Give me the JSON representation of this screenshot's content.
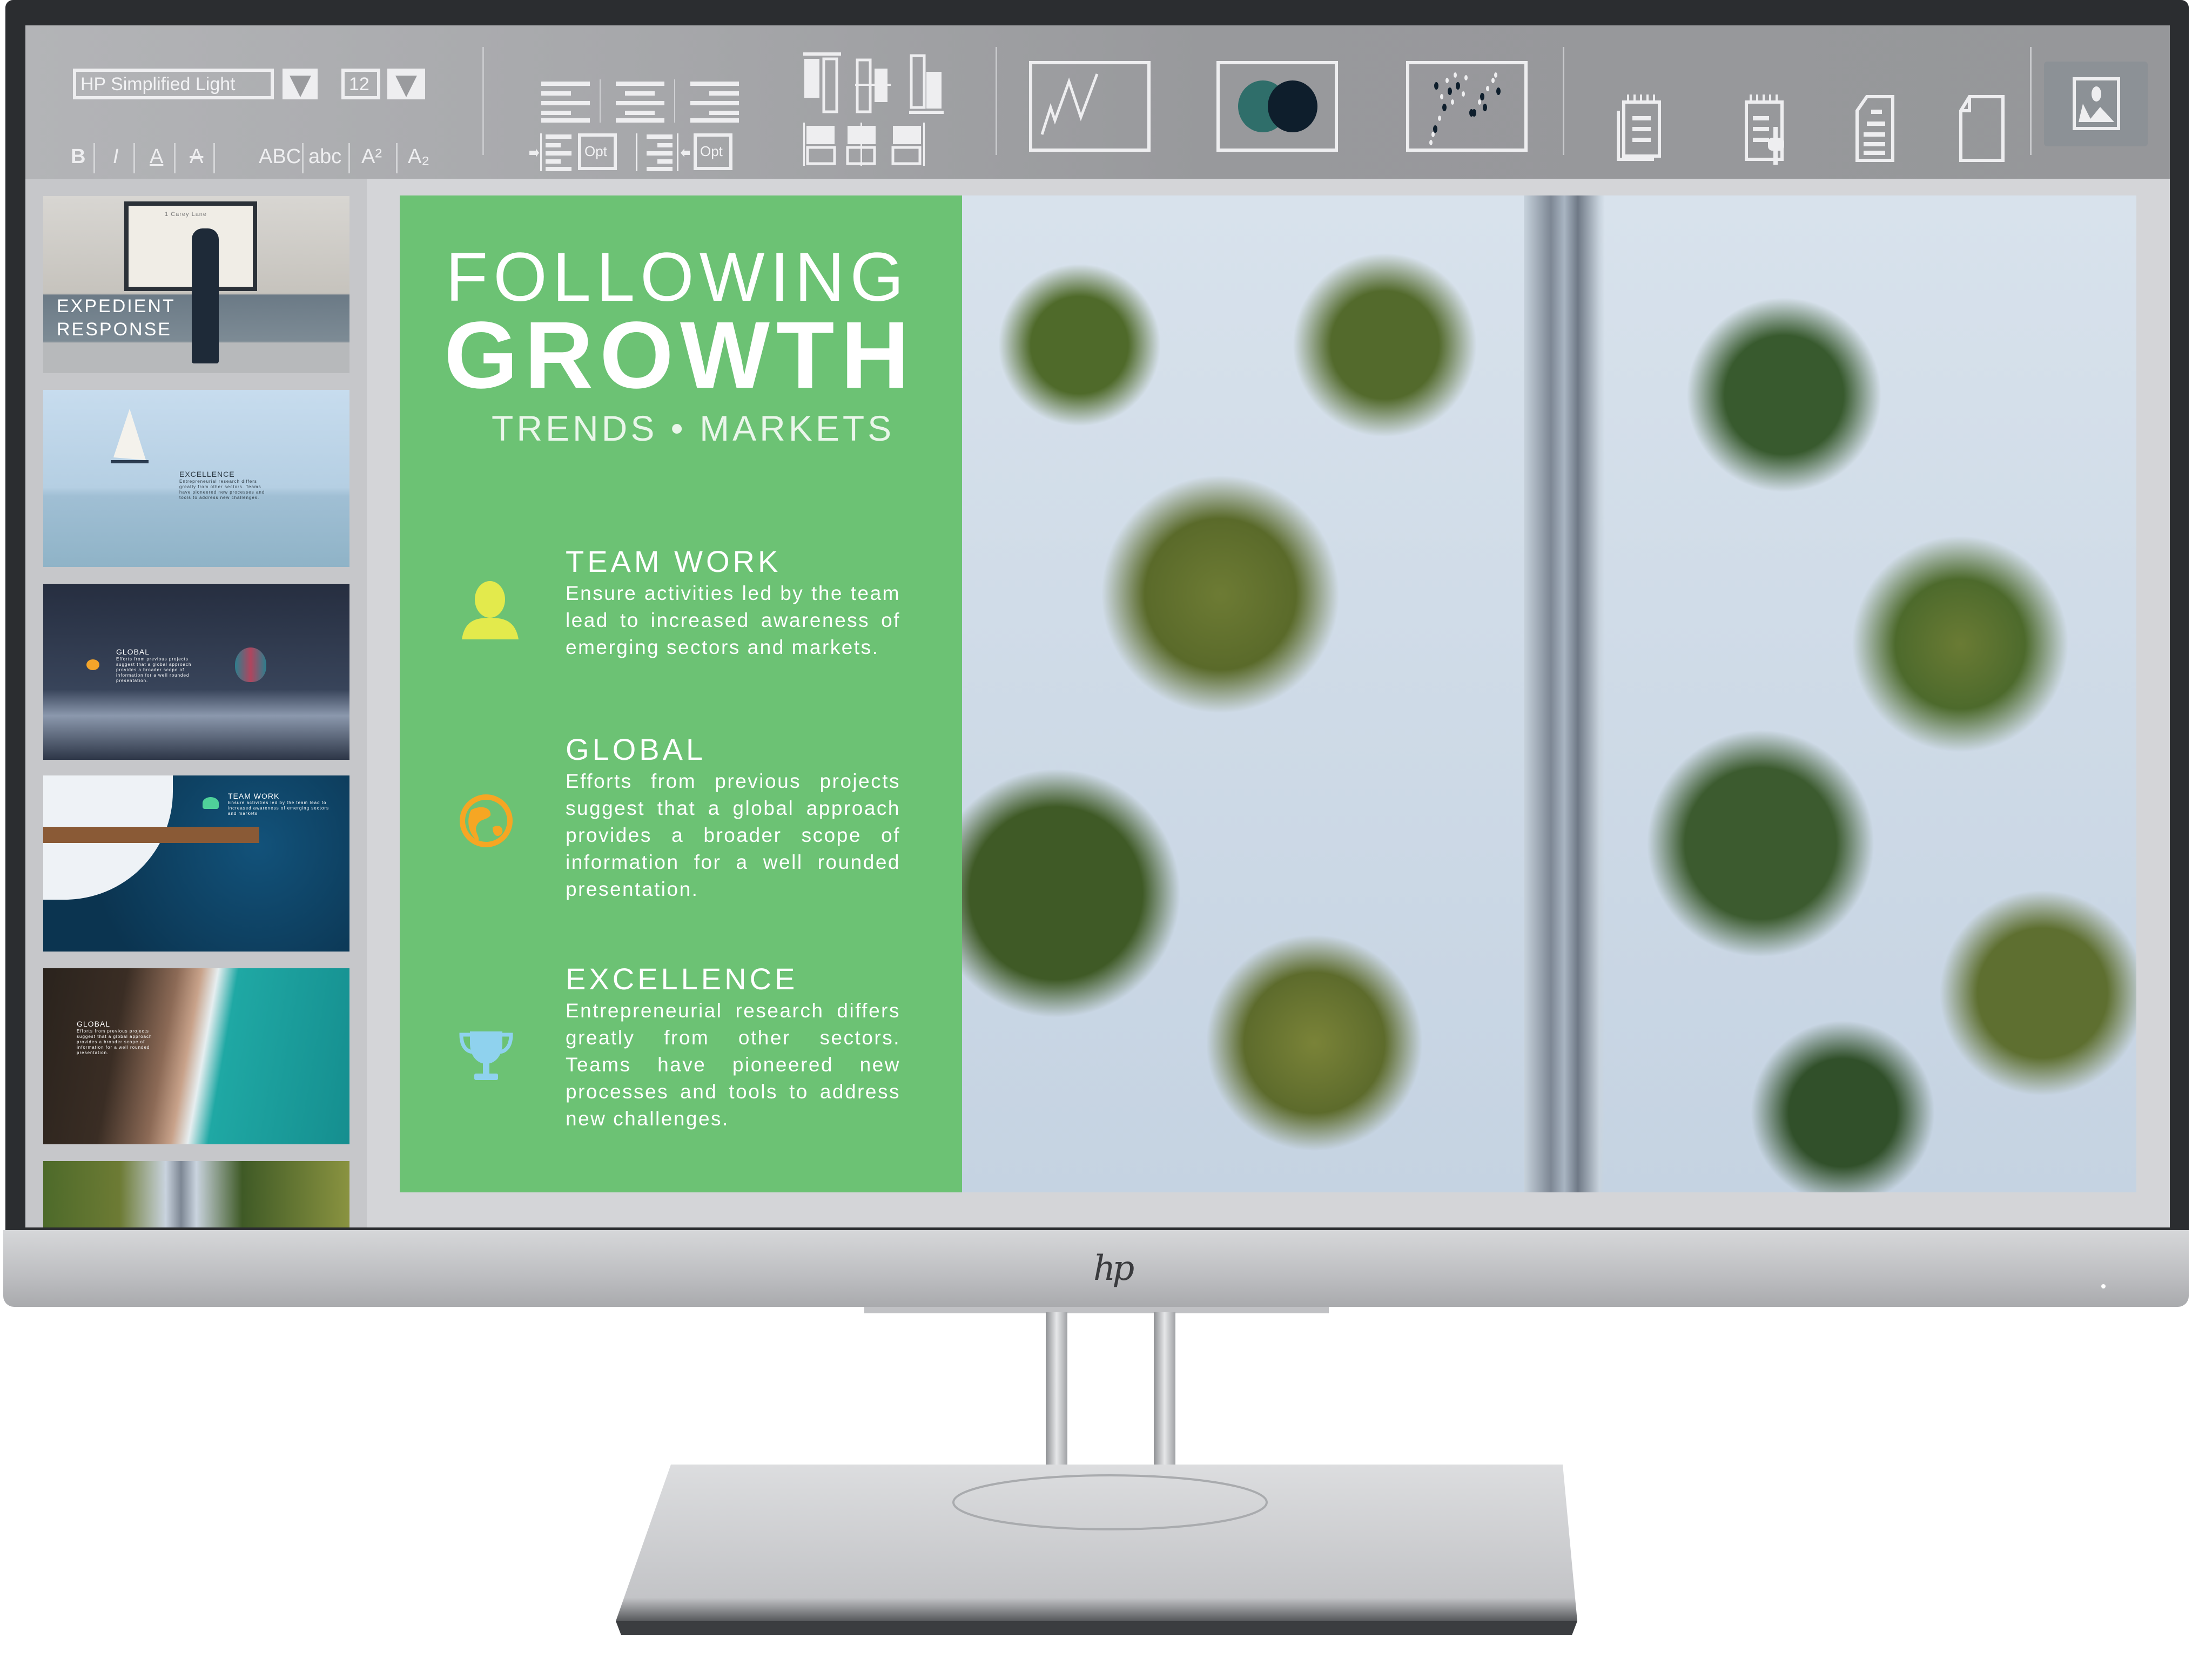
{
  "toolbar": {
    "font_name": "HP Simplified Light",
    "font_size": "12",
    "format_buttons": [
      "B",
      "I",
      "A",
      "A",
      "ABC",
      "abc",
      "A²",
      "A₂"
    ],
    "indent_left_label": "Opt",
    "indent_right_label": "Opt",
    "chart_buttons": [
      "line-chart-icon",
      "venn-chart-icon",
      "scatter-chart-icon"
    ],
    "doc_buttons": [
      "notepad-icon",
      "notepad-edit-icon",
      "document-icon",
      "blank-page-icon"
    ],
    "image_button": "image-icon",
    "accent_teal": "#2f6e6a",
    "accent_navy": "#0e1e2c"
  },
  "sidebar": {
    "thumbnails": [
      {
        "title_line1": "EXPEDIENT",
        "title_line2": "RESPONSE",
        "sign": "1 Carey Lane"
      },
      {
        "title": "EXCELLENCE",
        "body": "Entrepreneurial research differs greatly from other sectors. Teams have pioneered new processes and tools to address new challenges."
      },
      {
        "title": "GLOBAL",
        "body": "Efforts from previous projects suggest that a global approach provides a broader scope of information for a well rounded presentation."
      },
      {
        "title": "TEAM WORK",
        "body": "Ensure activities led by the team lead to increased awareness of emerging sectors and markets"
      },
      {
        "title": "GLOBAL",
        "body": "Efforts from previous projects suggest that a global approach provides a broader scope of information for a well rounded presentation."
      },
      {}
    ]
  },
  "slide": {
    "title_line1": "FOLLOWING",
    "title_line2": "GROWTH",
    "subtitle": "TRENDS • MARKETS",
    "panel_color": "#6cc274",
    "sections": [
      {
        "title": "TEAM WORK",
        "icon": "person-icon",
        "icon_color": "#e3ea4c",
        "body": "Ensure activities led by the team lead to increased awareness of emerging sectors and markets."
      },
      {
        "title": "GLOBAL",
        "icon": "globe-icon",
        "icon_color": "#f6a623",
        "body": "Efforts from previous projects suggest that a global approach provides a broader scope of information for a well rounded presentation."
      },
      {
        "title": "EXCELLENCE",
        "icon": "trophy-icon",
        "icon_color": "#8fd2ee",
        "body": "Entrepreneurial research differs greatly from other sectors. Teams have pioneered new processes and tools to address new challenges."
      }
    ]
  },
  "monitor": {
    "logo": "hp"
  }
}
